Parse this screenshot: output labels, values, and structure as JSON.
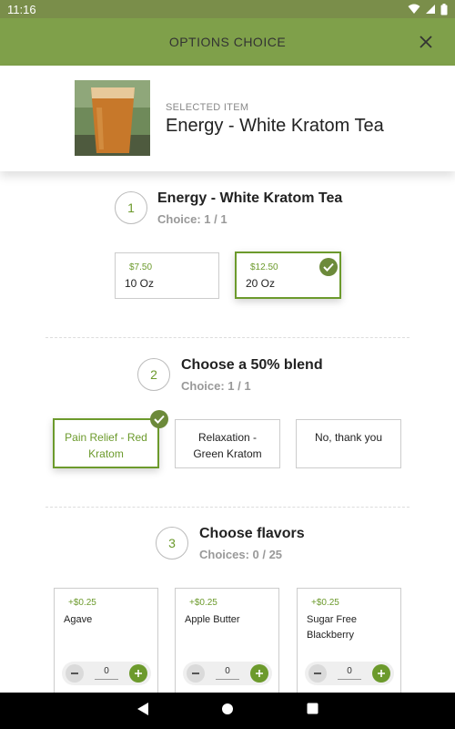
{
  "status_bar": {
    "time": "11:16"
  },
  "header": {
    "title": "OPTIONS CHOICE"
  },
  "selected_item": {
    "label": "SELECTED ITEM",
    "name": "Energy - White Kratom Tea"
  },
  "section1": {
    "number": "1",
    "title": "Energy - White Kratom Tea",
    "subtitle": "Choice: 1 / 1",
    "options": [
      {
        "price": "$7.50",
        "name": "10 Oz",
        "selected": false
      },
      {
        "price": "$12.50",
        "name": "20 Oz",
        "selected": true
      }
    ]
  },
  "section2": {
    "number": "2",
    "title": "Choose a 50% blend",
    "subtitle": "Choice: 1 / 1",
    "options": [
      {
        "name": "Pain Relief - Red Kratom",
        "selected": true
      },
      {
        "name": "Relaxation - Green Kratom",
        "selected": false
      },
      {
        "name": "No, thank you",
        "selected": false
      }
    ]
  },
  "section3": {
    "number": "3",
    "title": "Choose flavors",
    "subtitle": "Choices: 0 / 25",
    "flavors": [
      {
        "price": "+$0.25",
        "name": "Agave",
        "qty": "0"
      },
      {
        "price": "+$0.25",
        "name": "Apple Butter",
        "qty": "0"
      },
      {
        "price": "+$0.25",
        "name": "Sugar Free Blackberry",
        "qty": "0"
      }
    ]
  },
  "colors": {
    "accent": "#6c9a2c",
    "topbar": "#7fa04a",
    "statusbar": "#7a8e4a"
  }
}
